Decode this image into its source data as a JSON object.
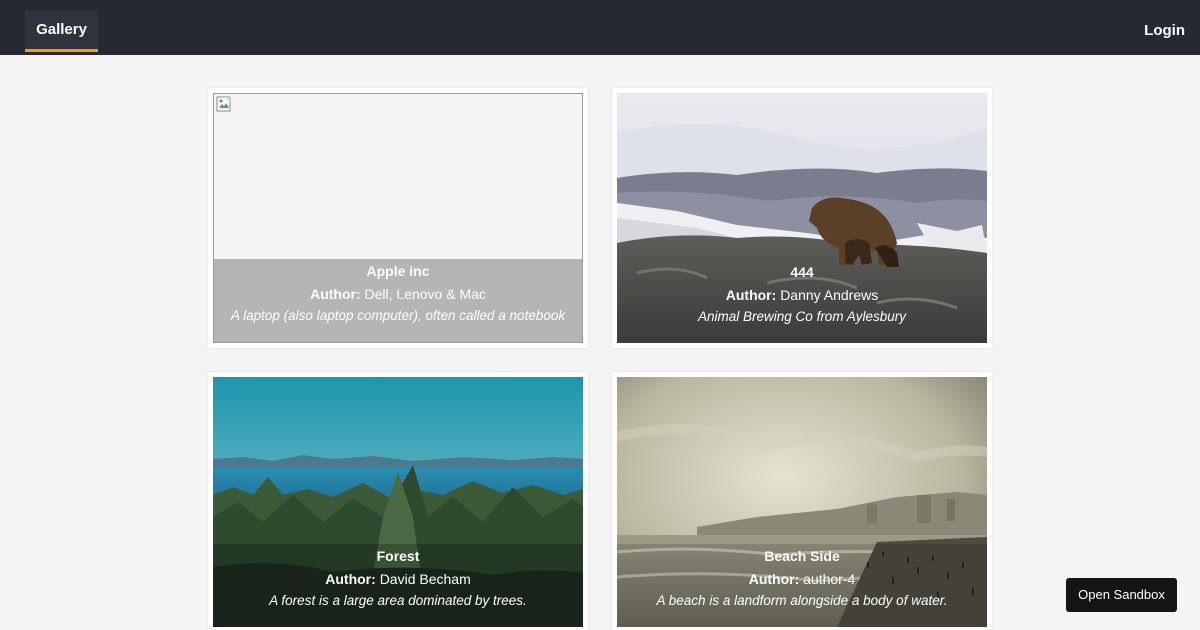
{
  "nav": {
    "tab_label": "Gallery",
    "login_label": "Login",
    "accent_color": "#f39c12",
    "bg_color": "#252932"
  },
  "cards": [
    {
      "title": "Apple inc",
      "author_label": "Author:",
      "author": "Dell, Lenovo & Mac",
      "description": "A laptop (also laptop computer), often called a notebook",
      "image": "broken-image-icon"
    },
    {
      "title": "444",
      "author_label": "Author:",
      "author": "Danny Andrews",
      "description": "Animal Brewing Co from Aylesbury",
      "image": "bear-on-rocks-photo"
    },
    {
      "title": "Forest",
      "author_label": "Author:",
      "author": "David Becham",
      "description": "A forest is a large area dominated by trees.",
      "image": "forest-lake-photo"
    },
    {
      "title": "Beach Side",
      "author_label": "Author:",
      "author": "author-4",
      "description": "A beach is a landform alongside a body of water.",
      "image": "beach-photo"
    }
  ],
  "sandbox": {
    "label": "Open Sandbox"
  }
}
